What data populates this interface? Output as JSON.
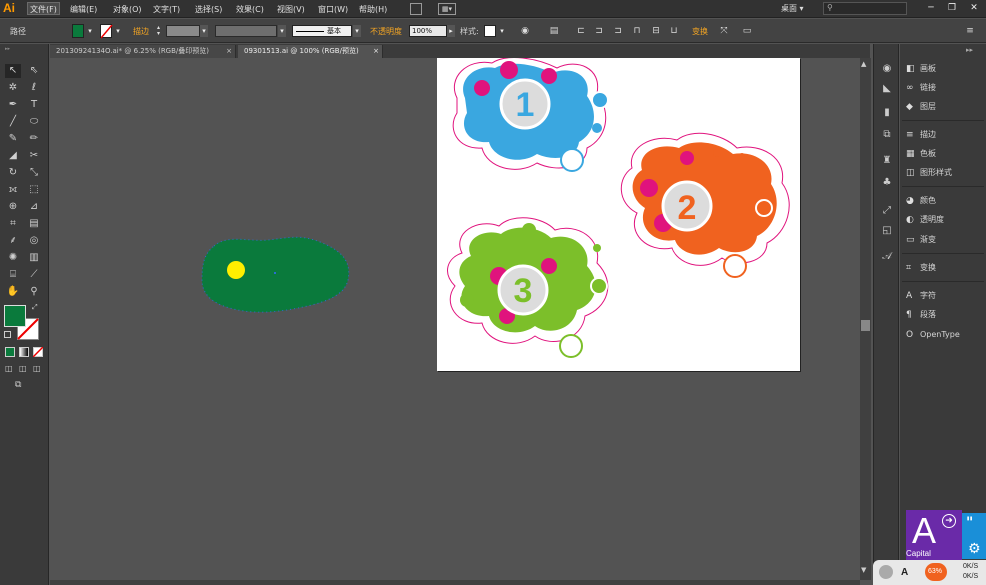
{
  "app": {
    "logo": "Ai"
  },
  "menu": [
    "文件(F)",
    "编辑(E)",
    "对象(O)",
    "文字(T)",
    "选择(S)",
    "效果(C)",
    "视图(V)",
    "窗口(W)",
    "帮助(H)"
  ],
  "workspace": "桌面 ▾",
  "window_controls": {
    "minimize": "─",
    "restore": "❐",
    "close": "✕"
  },
  "control_bar": {
    "object_label": "路径",
    "stroke_label": "描边",
    "brush_label": "基本",
    "opacity_label": "不透明度",
    "opacity_value": "100%",
    "style_label": "样式:",
    "transform_label": "变换"
  },
  "tabs": [
    {
      "label": "20130924134O.ai* @ 6.25% (RGB/叠印预览)",
      "close": "×"
    },
    {
      "label": "09301513.ai @ 100% (RGB/预览)",
      "close": "×"
    }
  ],
  "panels": [
    {
      "icon": "layers-icon",
      "glyph": "◧",
      "label": "画板"
    },
    {
      "icon": "links-icon",
      "glyph": "∞",
      "label": "链接"
    },
    {
      "icon": "layers-stack-icon",
      "glyph": "◆",
      "label": "图层"
    },
    {
      "icon": "stroke-icon",
      "glyph": "≡",
      "label": "描边"
    },
    {
      "icon": "swatches-icon",
      "glyph": "▦",
      "label": "色板"
    },
    {
      "icon": "graphic-styles-icon",
      "glyph": "◫",
      "label": "图形样式"
    },
    {
      "icon": "color-icon",
      "glyph": "◕",
      "label": "颜色"
    },
    {
      "icon": "transparency-icon",
      "glyph": "◐",
      "label": "透明度"
    },
    {
      "icon": "gradient-icon",
      "glyph": "▭",
      "label": "渐变"
    },
    {
      "icon": "transform-icon",
      "glyph": "⌗",
      "label": "变换"
    },
    {
      "icon": "character-icon",
      "glyph": "A",
      "label": "字符"
    },
    {
      "icon": "paragraph-icon",
      "glyph": "¶",
      "label": "段落"
    },
    {
      "icon": "opentype-icon",
      "glyph": "O",
      "label": "OpenType"
    }
  ],
  "artboard_badges": [
    "1",
    "2",
    "3"
  ],
  "overlay": {
    "letter": "A",
    "sub": "Capital"
  },
  "taskwidget": {
    "logo": "A",
    "percent": "63%",
    "up": "0K/S",
    "down": "0K/S"
  },
  "colors": {
    "fill": "#0a7a3c",
    "blue_flower": "#3aa7e0",
    "orange_flower": "#f0621f",
    "green_flower": "#7cbf2a",
    "magenta": "#e0137d",
    "selection": "#2a6fd1",
    "yellow_dot": "#ffee00"
  }
}
